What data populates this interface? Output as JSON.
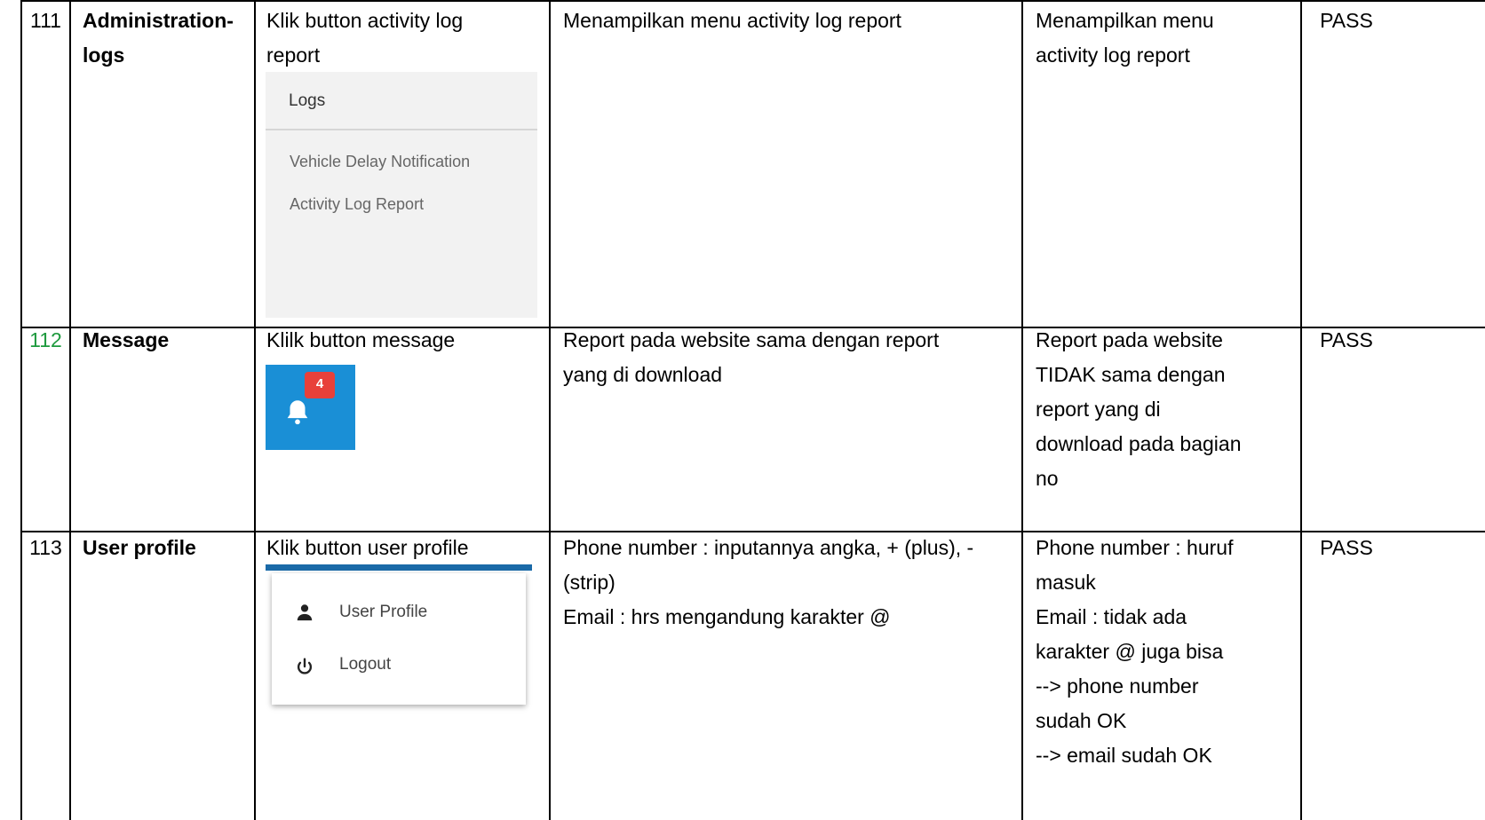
{
  "rows": [
    {
      "no": "111",
      "feature": "Administration-\nlogs",
      "action": "Klik button activity log\nreport",
      "expected": "Menampilkan menu activity log report",
      "actual": "Menampilkan menu\nactivity log report",
      "status": "PASS",
      "snippet": {
        "title": "Logs",
        "items": [
          "Vehicle Delay Notification",
          "Activity Log Report"
        ]
      }
    },
    {
      "no": "112",
      "feature": "Message",
      "action": "Klilk button message",
      "expected": "Report pada website sama dengan report\nyang di download",
      "actual": "Report pada website\nTIDAK sama dengan\nreport yang di\ndownload pada bagian\nno",
      "status": "PASS",
      "snippet": {
        "badge": "4",
        "icon": "bell-icon",
        "bg_color": "#1a8fd6",
        "badge_color": "#e8403a"
      }
    },
    {
      "no": "113",
      "feature": "User profile",
      "action": "Klik button user profile",
      "expected": "Phone number : inputannya angka, + (plus), -\n(strip)\nEmail : hrs mengandung karakter @",
      "actual": "Phone number : huruf\nmasuk\nEmail : tidak ada\nkarakter @ juga bisa\n--> phone number\nsudah OK\n--> email sudah OK",
      "status": "PASS",
      "snippet": {
        "items": [
          {
            "label": "User Profile",
            "icon": "user-icon"
          },
          {
            "label": "Logout",
            "icon": "power-icon"
          }
        ]
      }
    }
  ],
  "colors": {
    "row_number_highlight": "#1e9a3e"
  }
}
